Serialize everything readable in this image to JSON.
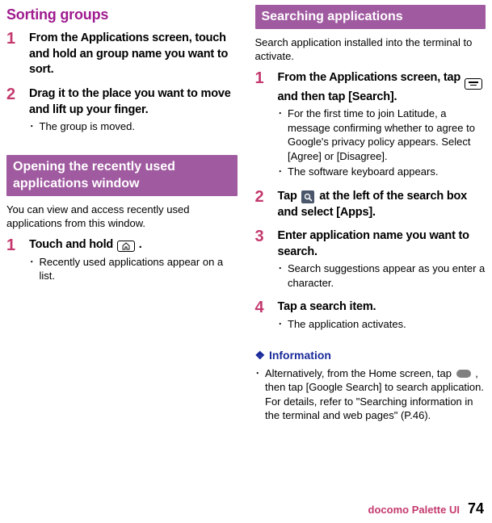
{
  "left": {
    "sorting_title": "Sorting groups",
    "sorting_steps": [
      {
        "num": "1",
        "title": "From the Applications screen, touch and hold an group name you want to sort.",
        "bullets": []
      },
      {
        "num": "2",
        "title": "Drag it to the place you want to move and lift up your finger.",
        "bullets": [
          "The group is moved."
        ]
      }
    ],
    "opening_bar": "Opening the recently used applications window",
    "opening_intro": "You can view and access recently used applications from this window.",
    "opening_steps": [
      {
        "num": "1",
        "title_pre": "Touch and hold ",
        "title_post": ".",
        "bullets": [
          "Recently used applications appear on a list."
        ]
      }
    ]
  },
  "right": {
    "search_bar": "Searching applications",
    "search_intro": "Search application installed into the terminal to activate.",
    "steps": {
      "s1": {
        "num": "1",
        "title_pre": "From the Applications screen, tap ",
        "title_post": " and then tap [Search].",
        "bullets": [
          "For the first time to join Latitude, a message confirming whether to agree to Google's privacy policy appears. Select [Agree] or [Disagree].",
          "The software keyboard appears."
        ]
      },
      "s2": {
        "num": "2",
        "title_pre": "Tap ",
        "title_post": " at the left of the search box and select [Apps].",
        "bullets": []
      },
      "s3": {
        "num": "3",
        "title": "Enter application name you want to search.",
        "bullets": [
          "Search suggestions appear as you enter a character."
        ]
      },
      "s4": {
        "num": "4",
        "title": "Tap a search item.",
        "bullets": [
          "The application activates."
        ]
      }
    },
    "info_heading": "Information",
    "info_bullet_pre": "Alternatively, from the Home screen, tap ",
    "info_bullet_post": ", then tap [Google Search] to search application. For details, refer to \"Searching information in the terminal and web pages\" (P.46)."
  },
  "footer": {
    "label": "docomo Palette UI",
    "page": "74"
  }
}
